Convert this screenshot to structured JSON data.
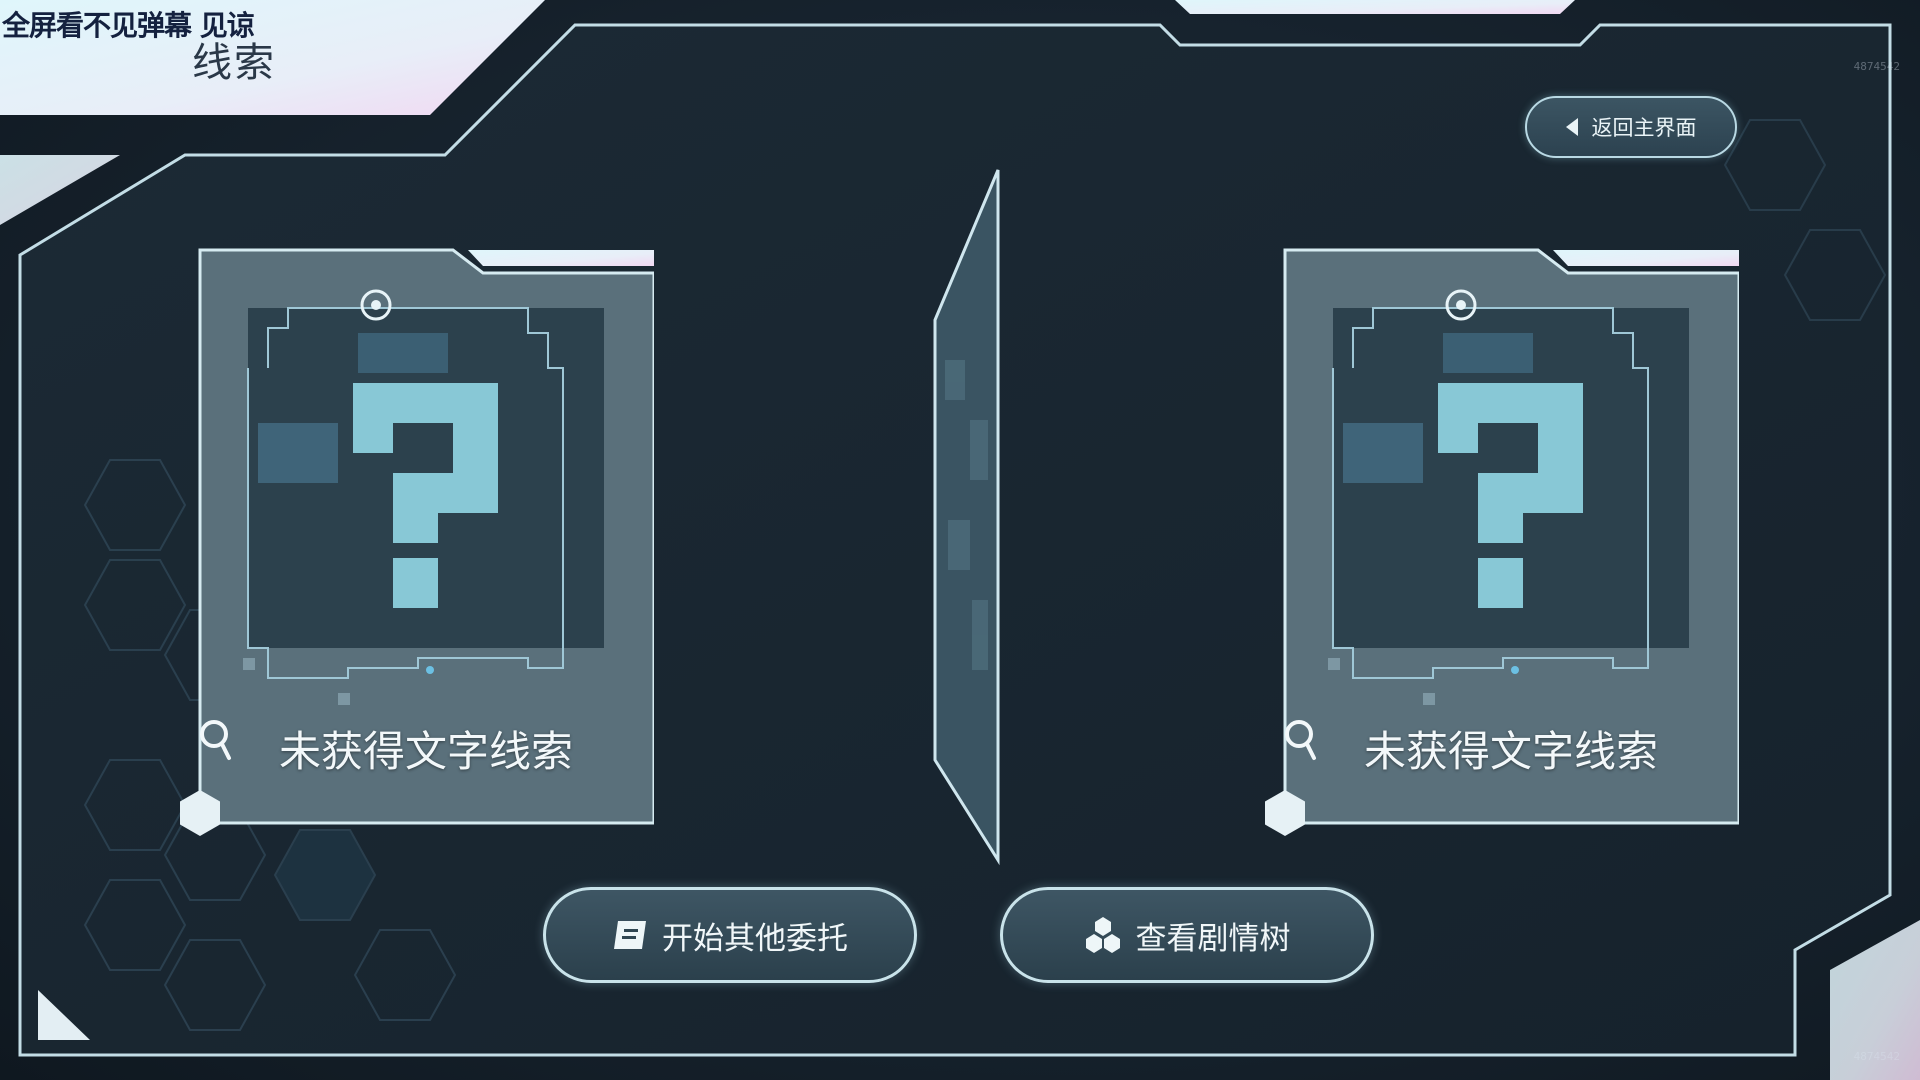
{
  "overlay": {
    "text": "全屏看不见弹幕 见谅"
  },
  "page": {
    "title": "线索"
  },
  "nav": {
    "back_label": "返回主界面"
  },
  "cards": [
    {
      "status": "未获得文字线索",
      "icon": "search-icon"
    },
    {
      "status": "未获得文字线索",
      "icon": "search-icon"
    }
  ],
  "actions": {
    "start_other": {
      "label": "开始其他委托",
      "icon": "document-icon"
    },
    "story_tree": {
      "label": "查看剧情树",
      "icon": "hexagon-cluster-icon"
    }
  },
  "watermark": {
    "id_top": "4874542",
    "id_bottom": "4874542"
  },
  "colors": {
    "accent": "#c9e3ea",
    "panel": "#1b2833",
    "highlight_gradient": [
      "#dff6fb",
      "#f3d9f3"
    ],
    "question_mark": "#88c8d6"
  }
}
